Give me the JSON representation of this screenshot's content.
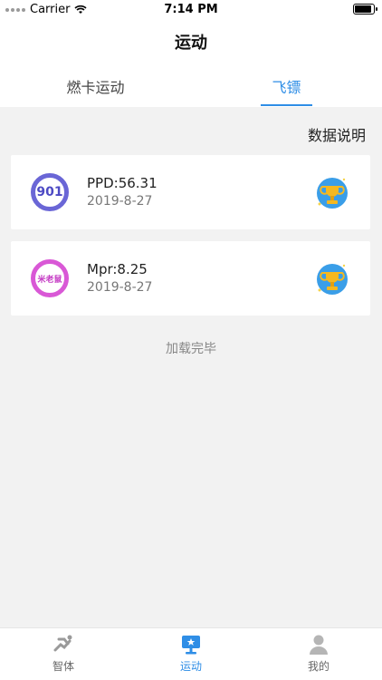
{
  "status_bar": {
    "carrier": "Carrier",
    "time": "7:14 PM"
  },
  "nav": {
    "title": "运动"
  },
  "top_tabs": [
    {
      "label": "燃卡运动",
      "active": false
    },
    {
      "label": "飞镖",
      "active": true
    }
  ],
  "data_note_label": "数据说明",
  "records": [
    {
      "logo_text": "901",
      "logo_icon": "901-logo-icon",
      "score": "PPD:56.31",
      "date": "2019-8-27",
      "trophy_icon": "trophy-icon"
    },
    {
      "logo_text": "米老鼠",
      "logo_icon": "mi-lao-shu-logo-icon",
      "score": "Mpr:8.25",
      "date": "2019-8-27",
      "trophy_icon": "trophy-icon"
    }
  ],
  "loaded_text": "加载完毕",
  "bottom_tabs": [
    {
      "label": "智体",
      "icon": "running-icon",
      "active": false
    },
    {
      "label": "运动",
      "icon": "dartboard-icon",
      "active": true
    },
    {
      "label": "我的",
      "icon": "user-icon",
      "active": false
    }
  ],
  "colors": {
    "accent": "#2f8ee6",
    "background": "#f2f2f2",
    "logo_901": "#6a66d6",
    "logo_mi": "#d958d6"
  }
}
